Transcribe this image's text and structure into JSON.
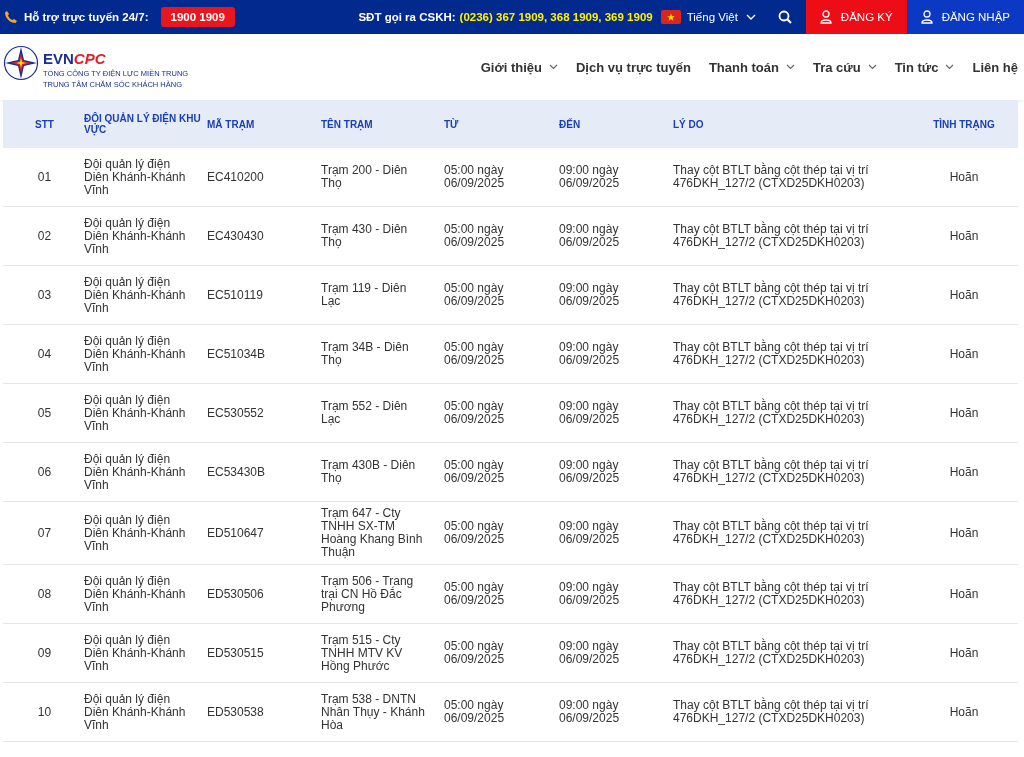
{
  "top_bar": {
    "support_label": "Hỗ trợ trực tuyến 24/7:",
    "hotline": "1900 1909",
    "cskh_label": "SĐT gọi ra CSKH:",
    "cskh_numbers": "(0236) 367 1909, 368 1909, 369 1909",
    "language": "Tiếng Việt",
    "register": "ĐĂNG KÝ",
    "login": "ĐĂNG NHẬP"
  },
  "logo": {
    "brand_evn": "EVN",
    "brand_cpc": "CPC",
    "line1": "TỔNG CÔNG TY ĐIỆN LỰC MIỀN TRUNG",
    "line2": "TRUNG TÂM CHĂM SÓC KHÁCH HÀNG"
  },
  "nav": [
    {
      "label": "Giới thiệu",
      "has_dropdown": true
    },
    {
      "label": "Dịch vụ trực tuyến",
      "has_dropdown": false
    },
    {
      "label": "Thanh toán",
      "has_dropdown": true
    },
    {
      "label": "Tra cứu",
      "has_dropdown": true
    },
    {
      "label": "Tin tức",
      "has_dropdown": true
    },
    {
      "label": "Liên hệ",
      "has_dropdown": false
    }
  ],
  "table": {
    "columns": [
      "STT",
      "ĐỘI QUẢN LÝ ĐIỆN KHU VỰC",
      "MÃ TRẠM",
      "TÊN TRẠM",
      "TỪ",
      "ĐẾN",
      "LÝ DO",
      "TÌNH TRẠNG"
    ],
    "rows": [
      [
        "01",
        "Đội quản lý điện Diên Khánh-Khánh Vĩnh",
        "EC410200",
        "Trạm 200 - Diên Thọ",
        "05:00 ngày 06/09/2025",
        "09:00 ngày 06/09/2025",
        "Thay cột BTLT bằng cột thép tại vị trí 476DKH_127/2 (CTXD25DKH0203)",
        "Hoãn"
      ],
      [
        "02",
        "Đội quản lý điện Diên Khánh-Khánh Vĩnh",
        "EC430430",
        "Trạm 430 - Diên Thọ",
        "05:00 ngày 06/09/2025",
        "09:00 ngày 06/09/2025",
        "Thay cột BTLT bằng cột thép tại vị trí 476DKH_127/2 (CTXD25DKH0203)",
        "Hoãn"
      ],
      [
        "03",
        "Đội quản lý điện Diên Khánh-Khánh Vĩnh",
        "EC510119",
        "Trạm 119 - Diên Lạc",
        "05:00 ngày 06/09/2025",
        "09:00 ngày 06/09/2025",
        "Thay cột BTLT bằng cột thép tại vị trí 476DKH_127/2 (CTXD25DKH0203)",
        "Hoãn"
      ],
      [
        "04",
        "Đội quản lý điện Diên Khánh-Khánh Vĩnh",
        "EC51034B",
        "Trạm 34B - Diên Thọ",
        "05:00 ngày 06/09/2025",
        "09:00 ngày 06/09/2025",
        "Thay cột BTLT bằng cột thép tại vị trí 476DKH_127/2 (CTXD25DKH0203)",
        "Hoãn"
      ],
      [
        "05",
        "Đội quản lý điện Diên Khánh-Khánh Vĩnh",
        "EC530552",
        "Trạm 552 - Diên Lạc",
        "05:00 ngày 06/09/2025",
        "09:00 ngày 06/09/2025",
        "Thay cột BTLT bằng cột thép tại vị trí 476DKH_127/2 (CTXD25DKH0203)",
        "Hoãn"
      ],
      [
        "06",
        "Đội quản lý điện Diên Khánh-Khánh Vĩnh",
        "EC53430B",
        "Trạm 430B - Diên Thọ",
        "05:00 ngày 06/09/2025",
        "09:00 ngày 06/09/2025",
        "Thay cột BTLT bằng cột thép tại vị trí 476DKH_127/2 (CTXD25DKH0203)",
        "Hoãn"
      ],
      [
        "07",
        "Đội quản lý điện Diên Khánh-Khánh Vĩnh",
        "ED510647",
        "Trạm 647 - Cty TNHH SX-TM Hoàng Khang Bình Thuận",
        "05:00 ngày 06/09/2025",
        "09:00 ngày 06/09/2025",
        "Thay cột BTLT bằng cột thép tại vị trí 476DKH_127/2 (CTXD25DKH0203)",
        "Hoãn"
      ],
      [
        "08",
        "Đội quản lý điện Diên Khánh-Khánh Vĩnh",
        "ED530506",
        "Trạm 506 - Trang trại CN Hồ Đắc Phương",
        "05:00 ngày 06/09/2025",
        "09:00 ngày 06/09/2025",
        "Thay cột BTLT bằng cột thép tại vị trí 476DKH_127/2 (CTXD25DKH0203)",
        "Hoãn"
      ],
      [
        "09",
        "Đội quản lý điện Diên Khánh-Khánh Vĩnh",
        "ED530515",
        "Trạm 515 - Cty TNHH MTV KV Hồng Phước",
        "05:00 ngày 06/09/2025",
        "09:00 ngày 06/09/2025",
        "Thay cột BTLT bằng cột thép tại vị trí 476DKH_127/2 (CTXD25DKH0203)",
        "Hoãn"
      ],
      [
        "10",
        "Đội quản lý điện Diên Khánh-Khánh Vĩnh",
        "ED530538",
        "Trạm 538 - DNTN Nhân Thụy - Khánh Hòa",
        "05:00 ngày 06/09/2025",
        "09:00 ngày 06/09/2025",
        "Thay cột BTLT bằng cột thép tại vị trí 476DKH_127/2 (CTXD25DKH0203)",
        "Hoãn"
      ]
    ]
  }
}
